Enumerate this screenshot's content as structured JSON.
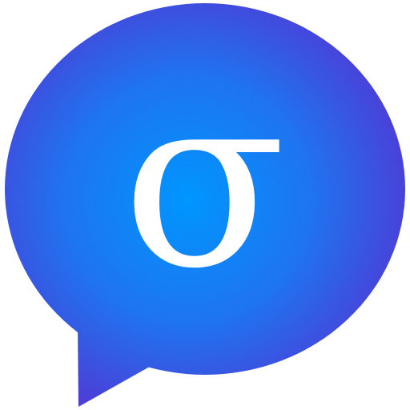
{
  "icon": {
    "name": "chat-bubble-sigma-icon",
    "glyph": "σ",
    "colors": {
      "center": "#0096ff",
      "edge": "#4b3fd8",
      "glyph": "#ffffff"
    }
  }
}
